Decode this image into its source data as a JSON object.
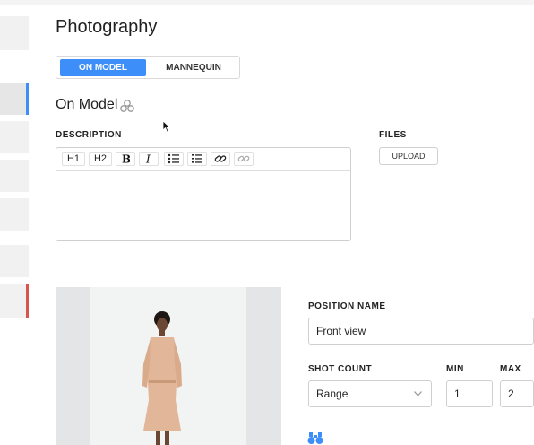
{
  "header": {
    "title": "Photography"
  },
  "view_toggle": {
    "options": [
      {
        "label": "ON MODEL",
        "selected": true
      },
      {
        "label": "MANNEQUIN",
        "selected": false
      }
    ]
  },
  "section": {
    "title": "On Model",
    "icon": "cluster-icon"
  },
  "description": {
    "label": "DESCRIPTION",
    "toolbar": [
      {
        "name": "h1",
        "text": "H1"
      },
      {
        "name": "h2",
        "text": "H2"
      },
      {
        "name": "bold",
        "icon": "bold-icon"
      },
      {
        "name": "italic",
        "icon": "italic-icon"
      },
      {
        "name": "bullet-list",
        "icon": "bullet-list-icon"
      },
      {
        "name": "numbered-list",
        "icon": "numbered-list-icon"
      },
      {
        "name": "link",
        "icon": "link-icon"
      },
      {
        "name": "unlink",
        "icon": "unlink-icon"
      }
    ],
    "value": ""
  },
  "files": {
    "label": "FILES",
    "upload_label": "UPLOAD"
  },
  "position": {
    "name_label": "POSITION NAME",
    "name_value": "Front view",
    "shot_count_label": "SHOT COUNT",
    "shot_count_value": "Range",
    "min_label": "MIN",
    "min_value": "1",
    "max_label": "MAX",
    "max_value": "2"
  },
  "colors": {
    "accent": "#3d8ef8",
    "rail_active_indicator": "#3d8ef8",
    "rail_error_indicator": "#d9534f"
  }
}
